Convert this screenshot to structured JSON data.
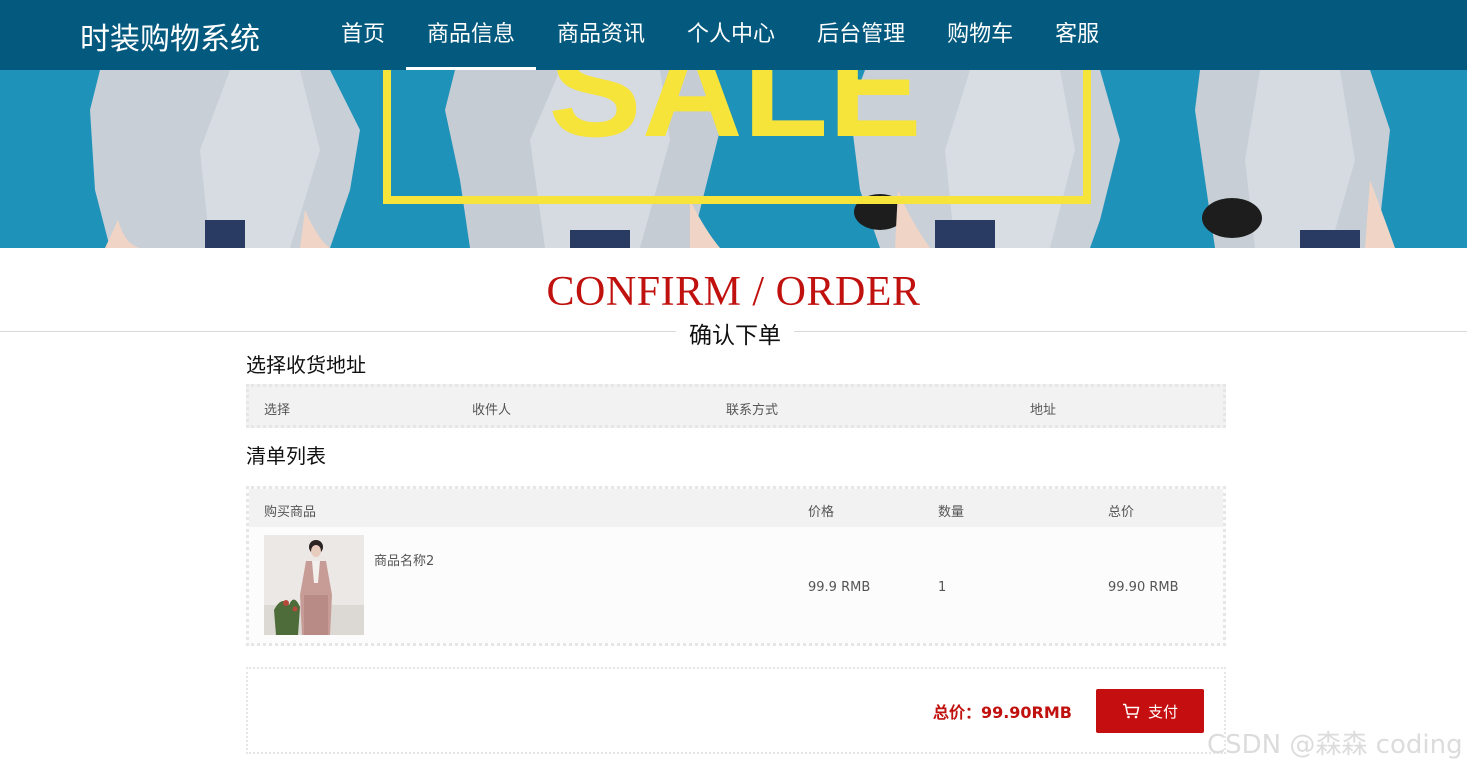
{
  "header": {
    "brand": "时装购物系统",
    "nav": [
      {
        "label": "首页",
        "active": false
      },
      {
        "label": "商品信息",
        "active": true
      },
      {
        "label": "商品资讯",
        "active": false
      },
      {
        "label": "个人中心",
        "active": false
      },
      {
        "label": "后台管理",
        "active": false
      },
      {
        "label": "购物车",
        "active": false
      },
      {
        "label": "客服",
        "active": false
      }
    ],
    "colors": {
      "background": "#035a7e",
      "text": "#ffffff"
    }
  },
  "banner": {
    "text": "SALE",
    "colors": {
      "background": "#1c8fb6",
      "accent": "#f6e43a"
    }
  },
  "page_title": {
    "english": "CONFIRM / ORDER",
    "chinese": "确认下单",
    "color": "#c0110e"
  },
  "address_section": {
    "title": "选择收货地址",
    "columns": [
      "选择",
      "收件人",
      "联系方式",
      "地址"
    ]
  },
  "list_section": {
    "title": "清单列表",
    "columns": [
      "购买商品",
      "价格",
      "数量",
      "总价"
    ],
    "rows": [
      {
        "name": "商品名称2",
        "price": "99.9 RMB",
        "quantity": "1",
        "total": "99.90 RMB",
        "image_icon": "product-photo"
      }
    ]
  },
  "summary": {
    "total_label": "总价：99.90RMB",
    "pay_label": "支付",
    "pay_icon": "cart-icon",
    "accent_color": "#c50e10"
  },
  "watermark": "CSDN @森森 coding"
}
